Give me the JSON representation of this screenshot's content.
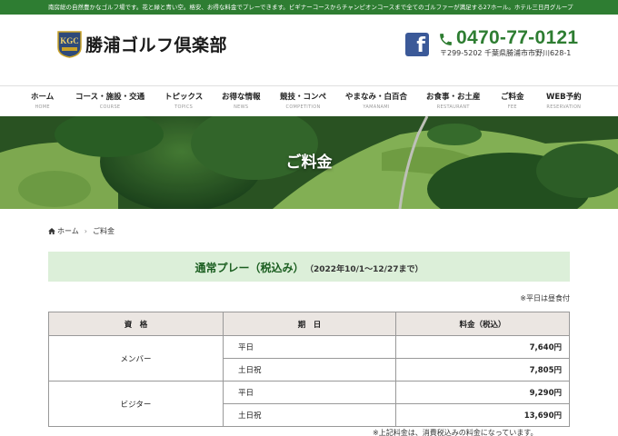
{
  "topbar": {
    "text": "南房総の自然豊かなゴルフ場です。花と緑と青い空。格安、お得な料金でプレーできます。ビギナーコースからチャンピオンコースまで全てのゴルファーが満足する27ホール。ホテル三日月グループ"
  },
  "header": {
    "logo_badge": "KGC",
    "logo_text": "勝浦ゴルフ倶楽部",
    "phone": "0470-77-0121",
    "address": "〒299-5202 千葉県勝浦市市野川628-1",
    "phone_color": "#2e7d32"
  },
  "nav": {
    "items": [
      {
        "jp": "ホーム",
        "en": "HOME"
      },
      {
        "jp": "コース・施設・交通",
        "en": "COURSE"
      },
      {
        "jp": "トピックス",
        "en": "TOPICS"
      },
      {
        "jp": "お得な情報",
        "en": "NEWS"
      },
      {
        "jp": "競技・コンペ",
        "en": "COMPETITION"
      },
      {
        "jp": "やまなみ・白百合",
        "en": "YAMANAMI"
      },
      {
        "jp": "お食事・お土産",
        "en": "RESTAURANT"
      },
      {
        "jp": "ご料金",
        "en": "FEE"
      },
      {
        "jp": "WEB予約",
        "en": "RESERVATION"
      }
    ]
  },
  "hero": {
    "title": "ご料金"
  },
  "breadcrumb": {
    "home": "ホーム",
    "current": "ご料金"
  },
  "section": {
    "title": "通常プレー（税込み）",
    "period": "（2022年10/1～12/27まで）"
  },
  "note_top": "※平日は昼食付",
  "table": {
    "headers": [
      "資　格",
      "期　日",
      "料金（税込）"
    ],
    "groups": [
      {
        "type": "メンバー",
        "rows": [
          {
            "day": "平日",
            "price": "7,640円"
          },
          {
            "day": "土日祝",
            "price": "7,805円"
          }
        ]
      },
      {
        "type": "ビジター",
        "rows": [
          {
            "day": "平日",
            "price": "9,290円"
          },
          {
            "day": "土日祝",
            "price": "13,690円"
          }
        ]
      }
    ]
  },
  "note_bottom": "※上記料金は、消費税込みの料金になっています。"
}
